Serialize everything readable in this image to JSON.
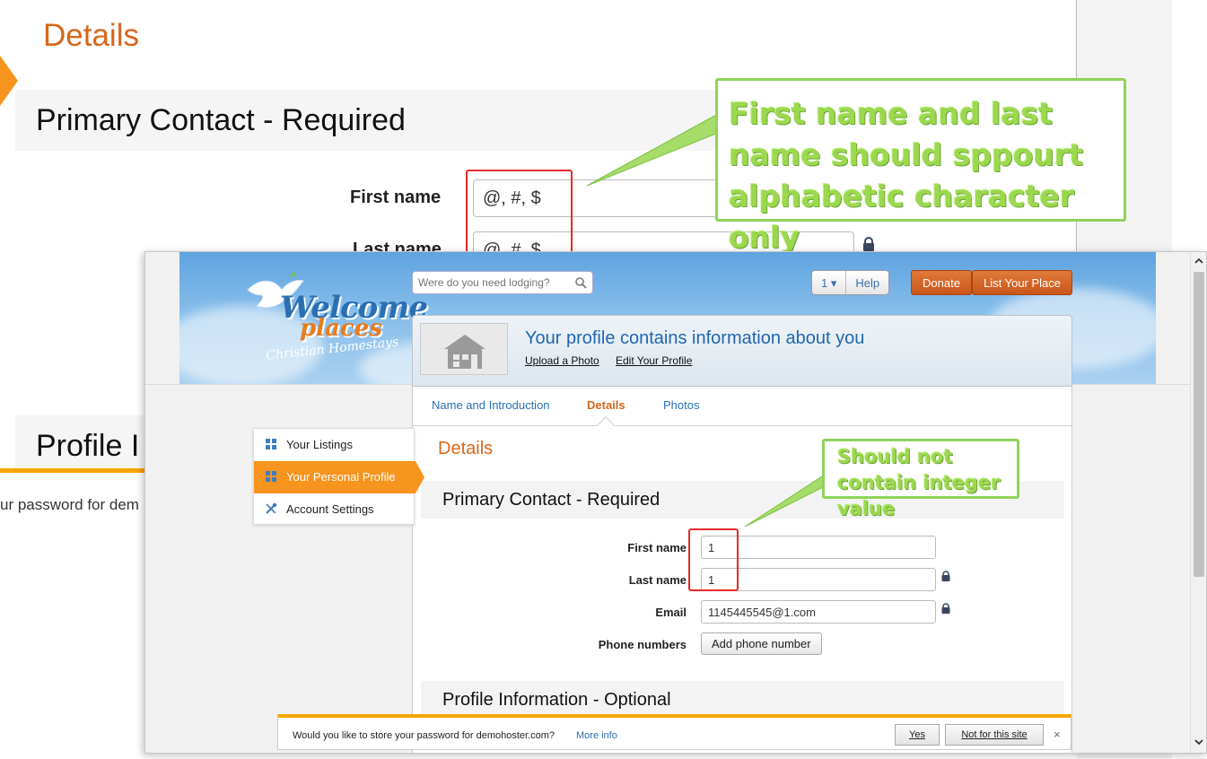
{
  "background": {
    "title": "Details",
    "section_title": "Primary Contact - Required",
    "first_name_label": "First name",
    "first_name_value": "@, #, $",
    "last_name_label": "Last name",
    "last_name_value": "@, #, $",
    "profile_section_partial": "Profile I",
    "password_text_partial": "ur password for dem"
  },
  "callouts": {
    "top": "First name and last name should sppourt alphabetic character only",
    "bottom": "Should not contain integer value"
  },
  "header": {
    "search_placeholder": "Were do you need lodging?",
    "account_btn": "1 ▾",
    "help_btn": "Help",
    "donate_btn": "Donate",
    "list_place_btn": "List Your Place",
    "logo_line1": "Welcome",
    "logo_line2": "places",
    "logo_line3": "Christian Homestays"
  },
  "profile": {
    "title": "Your profile contains information about you",
    "upload_link": "Upload a Photo",
    "edit_link": "Edit Your Profile"
  },
  "tabs": [
    {
      "label": "Name and Introduction",
      "active": false
    },
    {
      "label": "Details",
      "active": true
    },
    {
      "label": "Photos",
      "active": false
    }
  ],
  "sidebar": {
    "items": [
      {
        "label": "Your Listings",
        "icon": "grid-icon",
        "active": false
      },
      {
        "label": "Your Personal Profile",
        "icon": "grid-icon",
        "active": true
      },
      {
        "label": "Account Settings",
        "icon": "tools-icon",
        "active": false
      }
    ]
  },
  "form": {
    "panel_title": "Details",
    "section_title": "Primary Contact - Required",
    "first_name_label": "First name",
    "first_name_value": "1",
    "last_name_label": "Last name",
    "last_name_value": "1",
    "email_label": "Email",
    "email_value": "1145445545@1.com",
    "phone_label": "Phone numbers",
    "add_phone_btn": "Add phone number",
    "optional_section_title": "Profile Information - Optional"
  },
  "password_bar": {
    "text": "Would you like to store your password for demohoster.com?",
    "more_info": "More info",
    "yes_btn": "Yes",
    "no_btn": "Not for this site",
    "close": "×"
  },
  "colors": {
    "accent_orange": "#d8661b",
    "link_blue": "#2b6fb3",
    "callout_green": "#8fd35a",
    "error_red": "#e52a2a"
  }
}
